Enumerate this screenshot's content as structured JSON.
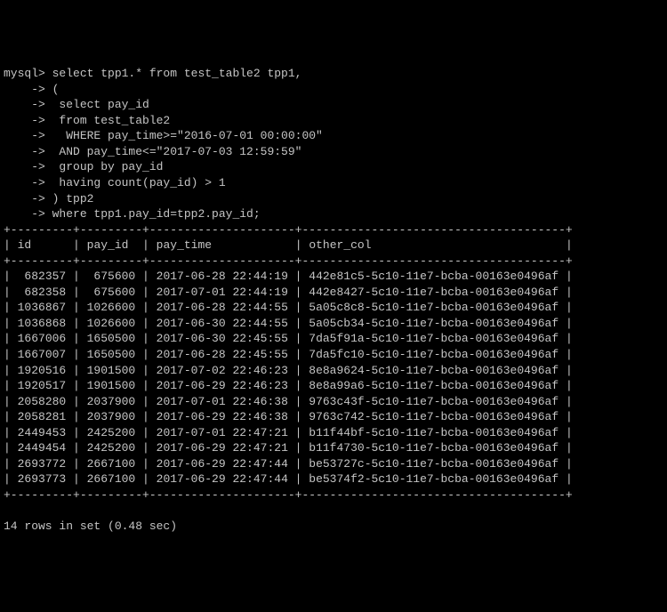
{
  "prompt": "mysql>",
  "continuation": "    ->",
  "query_lines": [
    " select tpp1.* from test_table2 tpp1,",
    " (",
    "  select pay_id",
    "  from test_table2",
    "   WHERE pay_time>=\"2016-07-01 00:00:00\"",
    "  AND pay_time<=\"2017-07-03 12:59:59\"",
    "  group by pay_id",
    "  having count(pay_id) > 1",
    " ) tpp2",
    " where tpp1.pay_id=tpp2.pay_id;"
  ],
  "border": "+---------+---------+---------------------+--------------------------------------+",
  "headers": {
    "id": "id",
    "pay_id": "pay_id",
    "pay_time": "pay_time",
    "other_col": "other_col"
  },
  "rows": [
    {
      "id": " 682357",
      "pay_id": " 675600",
      "pay_time": "2017-06-28 22:44:19",
      "other_col": "442e81c5-5c10-11e7-bcba-00163e0496af"
    },
    {
      "id": " 682358",
      "pay_id": " 675600",
      "pay_time": "2017-07-01 22:44:19",
      "other_col": "442e8427-5c10-11e7-bcba-00163e0496af"
    },
    {
      "id": "1036867",
      "pay_id": "1026600",
      "pay_time": "2017-06-28 22:44:55",
      "other_col": "5a05c8c8-5c10-11e7-bcba-00163e0496af"
    },
    {
      "id": "1036868",
      "pay_id": "1026600",
      "pay_time": "2017-06-30 22:44:55",
      "other_col": "5a05cb34-5c10-11e7-bcba-00163e0496af"
    },
    {
      "id": "1667006",
      "pay_id": "1650500",
      "pay_time": "2017-06-30 22:45:55",
      "other_col": "7da5f91a-5c10-11e7-bcba-00163e0496af"
    },
    {
      "id": "1667007",
      "pay_id": "1650500",
      "pay_time": "2017-06-28 22:45:55",
      "other_col": "7da5fc10-5c10-11e7-bcba-00163e0496af"
    },
    {
      "id": "1920516",
      "pay_id": "1901500",
      "pay_time": "2017-07-02 22:46:23",
      "other_col": "8e8a9624-5c10-11e7-bcba-00163e0496af"
    },
    {
      "id": "1920517",
      "pay_id": "1901500",
      "pay_time": "2017-06-29 22:46:23",
      "other_col": "8e8a99a6-5c10-11e7-bcba-00163e0496af"
    },
    {
      "id": "2058280",
      "pay_id": "2037900",
      "pay_time": "2017-07-01 22:46:38",
      "other_col": "9763c43f-5c10-11e7-bcba-00163e0496af"
    },
    {
      "id": "2058281",
      "pay_id": "2037900",
      "pay_time": "2017-06-29 22:46:38",
      "other_col": "9763c742-5c10-11e7-bcba-00163e0496af"
    },
    {
      "id": "2449453",
      "pay_id": "2425200",
      "pay_time": "2017-07-01 22:47:21",
      "other_col": "b11f44bf-5c10-11e7-bcba-00163e0496af"
    },
    {
      "id": "2449454",
      "pay_id": "2425200",
      "pay_time": "2017-06-29 22:47:21",
      "other_col": "b11f4730-5c10-11e7-bcba-00163e0496af"
    },
    {
      "id": "2693772",
      "pay_id": "2667100",
      "pay_time": "2017-06-29 22:47:44",
      "other_col": "be53727c-5c10-11e7-bcba-00163e0496af"
    },
    {
      "id": "2693773",
      "pay_id": "2667100",
      "pay_time": "2017-06-29 22:47:44",
      "other_col": "be5374f2-5c10-11e7-bcba-00163e0496af"
    }
  ],
  "footer": "14 rows in set (0.48 sec)"
}
